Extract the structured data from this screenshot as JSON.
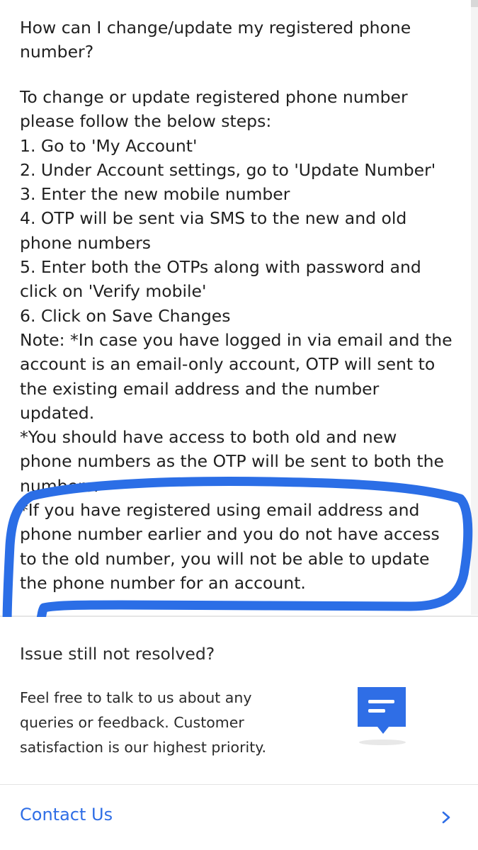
{
  "faq": {
    "question": "How can I change/update my registered phone number?",
    "intro_lines": [
      "To change or update registered phone number",
      "please follow the below steps:"
    ],
    "steps": [
      "1. Go to 'My Account'",
      "2. Under Account settings, go to 'Update Number'",
      "3. Enter the new mobile number",
      "4. OTP will be sent via SMS to the new and old",
      "phone numbers",
      "5. Enter both the OTPs along with password and",
      "click on 'Verify mobile'",
      "6. Click on Save Changes"
    ],
    "notes": [
      "Note: *In case you have logged in via email and the",
      "account is an email-only account, OTP will sent to",
      "the existing email address and the number",
      "updated.",
      "*You should have access to both old and new",
      "phone numbers as the OTP will be sent to both the",
      "numbers."
    ],
    "highlighted_note": [
      "*If you have registered using email address and",
      "phone number earlier and you do not have access",
      "to the old number, you will not be able to update",
      "the phone number for an account."
    ]
  },
  "colors": {
    "annotation": "#2b6ee6",
    "link": "#2f6ee6",
    "icon": "#2f6ee6"
  },
  "support": {
    "title": "Issue still not resolved?",
    "description": "Feel free to talk to us about any queries or feedback. Customer satisfaction is our highest priority.",
    "icon": "chat-message-icon"
  },
  "contact": {
    "label": "Contact Us",
    "icon": "chevron-right-icon"
  }
}
